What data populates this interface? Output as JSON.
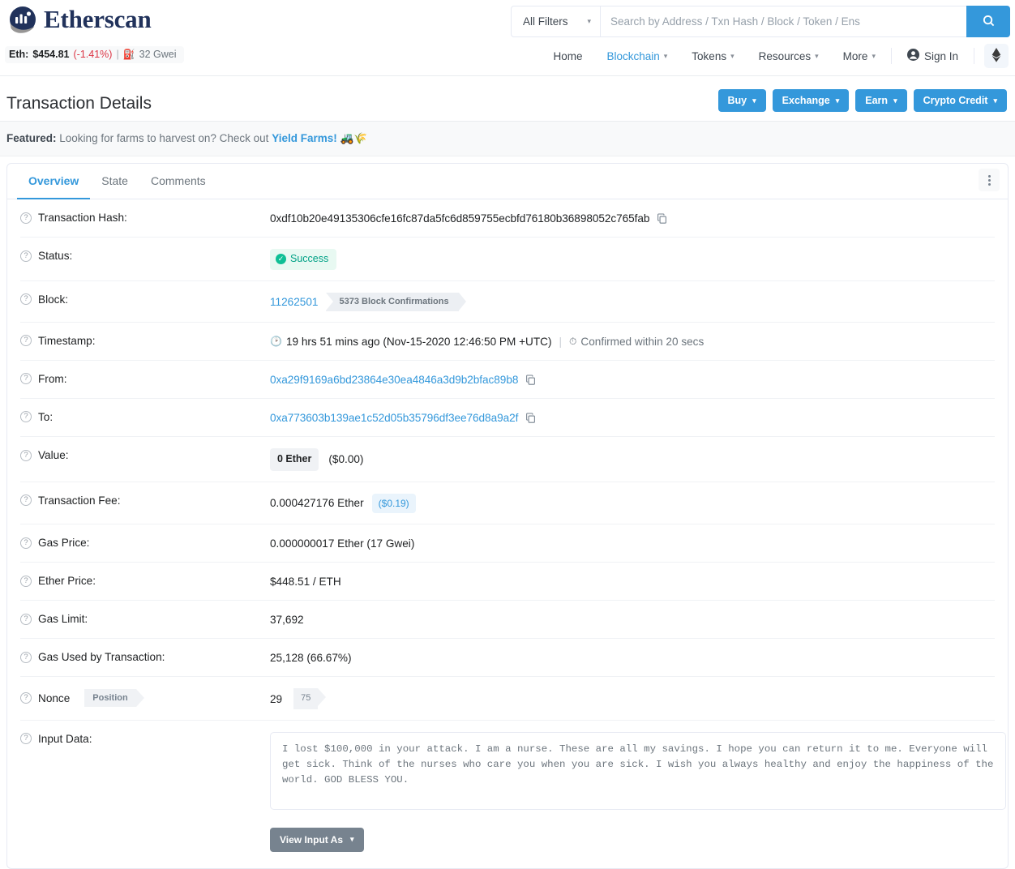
{
  "header": {
    "brand": "Etherscan",
    "eth_label": "Eth:",
    "eth_price": "$454.81",
    "eth_change": "(-1.41%)",
    "separator": "|",
    "gas_gwei": "32 Gwei",
    "search": {
      "filter_label": "All Filters",
      "placeholder": "Search by Address / Txn Hash / Block / Token / Ens",
      "value": ""
    },
    "nav": [
      {
        "label": "Home",
        "active": false,
        "has_caret": false
      },
      {
        "label": "Blockchain",
        "active": true,
        "has_caret": true
      },
      {
        "label": "Tokens",
        "active": false,
        "has_caret": true
      },
      {
        "label": "Resources",
        "active": false,
        "has_caret": true
      },
      {
        "label": "More",
        "active": false,
        "has_caret": true
      }
    ],
    "sign_in": "Sign In"
  },
  "page": {
    "title": "Transaction Details",
    "actions": [
      {
        "label": "Buy"
      },
      {
        "label": "Exchange"
      },
      {
        "label": "Earn"
      },
      {
        "label": "Crypto Credit"
      }
    ]
  },
  "featured": {
    "prefix": "Featured:",
    "text": "Looking for farms to harvest on? Check out",
    "link": "Yield Farms!",
    "emoji": "🚜🌾"
  },
  "tabs": [
    {
      "label": "Overview",
      "active": true
    },
    {
      "label": "State",
      "active": false
    },
    {
      "label": "Comments",
      "active": false
    }
  ],
  "details": {
    "labels": {
      "tx_hash": "Transaction Hash:",
      "status": "Status:",
      "block": "Block:",
      "timestamp": "Timestamp:",
      "from": "From:",
      "to": "To:",
      "value": "Value:",
      "tx_fee": "Transaction Fee:",
      "gas_price": "Gas Price:",
      "ether_price": "Ether Price:",
      "gas_limit": "Gas Limit:",
      "gas_used": "Gas Used by Transaction:",
      "nonce": "Nonce",
      "nonce_position": "Position",
      "input_data": "Input Data:"
    },
    "tx_hash": "0xdf10b20e49135306cfe16fc87da5fc6d859755ecbfd76180b36898052c765fab",
    "status": "Success",
    "block_number": "11262501",
    "block_confirmations": "5373 Block Confirmations",
    "timestamp_age": "19 hrs 51 mins ago (Nov-15-2020 12:46:50 PM +UTC)",
    "timestamp_confirmed": "Confirmed within 20 secs",
    "timestamp_pipe": "|",
    "from_address": "0xa29f9169a6bd23864e30ea4846a3d9b2bfac89b8",
    "to_address": "0xa773603b139ae1c52d05b35796df3ee76d8a9a2f",
    "value_ether": "0 Ether",
    "value_usd": "($0.00)",
    "tx_fee_ether": "0.000427176 Ether",
    "tx_fee_usd": "($0.19)",
    "gas_price": "0.000000017 Ether (17 Gwei)",
    "ether_price": "$448.51 / ETH",
    "gas_limit": "37,692",
    "gas_used": "25,128 (66.67%)",
    "nonce_value": "29",
    "nonce_pos_value": "75",
    "input_data_text": "I lost $100,000 in your attack. I am a nurse. These are all my savings. I hope you can return it to me. Everyone will get sick. Think of the nurses who care you when you are sick. I wish you always healthy and enjoy the happiness of the world. GOD BLESS YOU.",
    "view_input_as": "View Input As"
  },
  "colors": {
    "accent": "#3498db",
    "brand_dark": "#21325b",
    "success": "#00a186",
    "danger": "#dc3545",
    "muted": "#6c757d"
  }
}
